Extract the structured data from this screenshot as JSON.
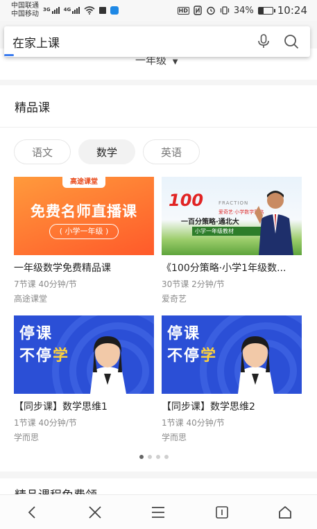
{
  "status_bar": {
    "carrier1": "中国联通",
    "carrier2": "中国移动",
    "net1": "3G",
    "net2": "4G",
    "hd": "HD",
    "battery": "34%",
    "battery_level": 0.34,
    "time": "10:24"
  },
  "search": {
    "query": "在家上课",
    "mic_icon": "mic-icon",
    "search_icon": "search-icon"
  },
  "grade_filter": {
    "label": "一年级"
  },
  "section": {
    "title": "精品课",
    "tabs": [
      {
        "label": "语文",
        "active": false
      },
      {
        "label": "数学",
        "active": true
      },
      {
        "label": "英语",
        "active": false
      }
    ],
    "courses": [
      {
        "title": "一年级数学免费精品课",
        "meta": "7节课 40分钟/节",
        "source": "高途课堂",
        "thumb": {
          "badge": "高途课堂",
          "headline": "免费名师直播课",
          "sub": "( 小学一年级 )"
        }
      },
      {
        "title": "《100分策略·小学1年级数...",
        "meta": "30节课 2分钟/节",
        "source": "爱奇艺",
        "thumb": {
          "logo": "100",
          "frac": "FRACTION",
          "tag": "爱奇艺·小学数学策略",
          "headline": "一百分策略·通北大",
          "band": "小学一年级教材"
        }
      },
      {
        "title": "【同步课】数学思维1",
        "meta": "1节课 40分钟/节",
        "source": "学而思",
        "thumb": {
          "line1": "停课",
          "line2a": "不停",
          "line2b": "学"
        }
      },
      {
        "title": "【同步课】数学思维2",
        "meta": "1节课 40分钟/节",
        "source": "学而思",
        "thumb": {
          "line1": "停课",
          "line2a": "不停",
          "line2b": "学"
        }
      }
    ],
    "pager": {
      "total": 4,
      "active": 0
    }
  },
  "next_section": {
    "title": "精品课程免费领"
  },
  "bottom_nav": [
    "back-icon",
    "close-icon",
    "menu-icon",
    "tabs-icon",
    "home-icon"
  ],
  "colors": {
    "accent": "#3b7cf0",
    "orange": "#ff6a2c",
    "blue_thumb": "#2b4fd6"
  }
}
